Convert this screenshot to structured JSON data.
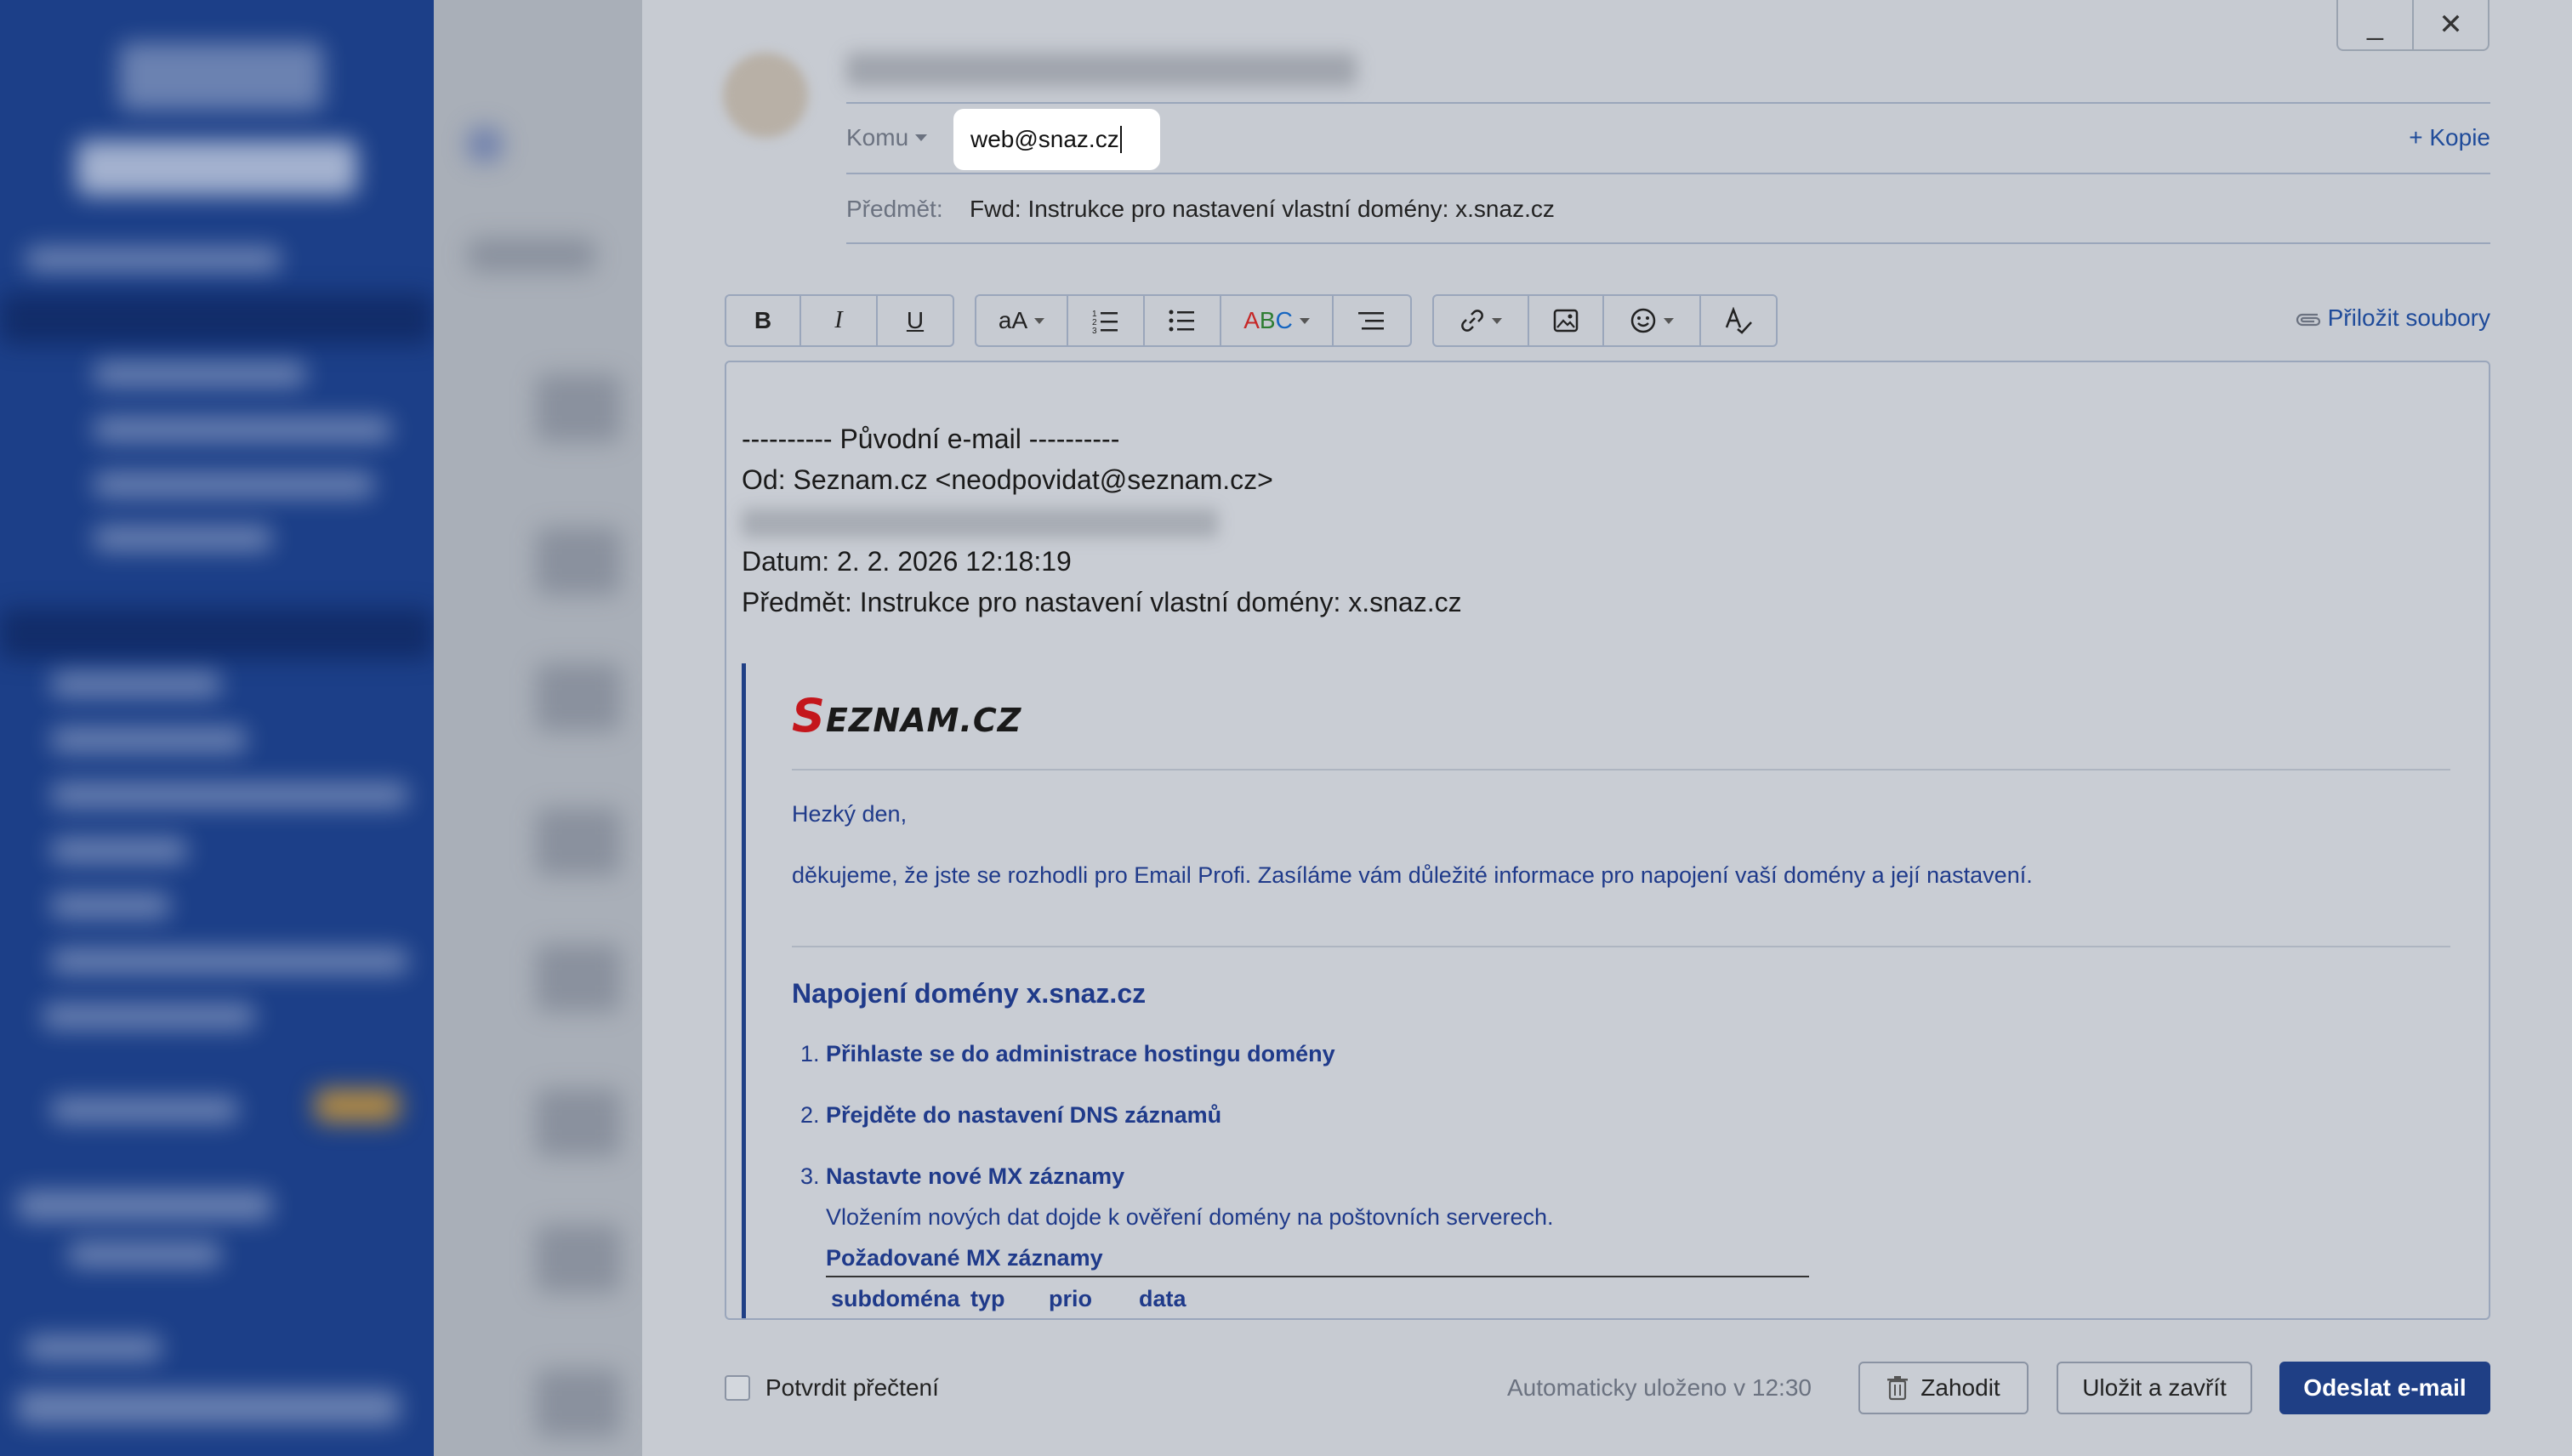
{
  "window": {
    "minimize_glyph": "_",
    "close_glyph": "✕"
  },
  "header": {
    "to_label": "Komu",
    "to_value": "web@snaz.cz",
    "cc_link": "+ Kopie",
    "subject_label": "Předmět:",
    "subject_value": "Fwd: Instrukce pro nastavení vlastní domény: x.snaz.cz"
  },
  "toolbar": {
    "bold": "B",
    "italic": "I",
    "underline": "U",
    "font_size": "aA",
    "text_color": "ABC",
    "attach_label": "Přiložit soubory",
    "icons": [
      "bold-icon",
      "italic-icon",
      "underline-icon",
      "font-size-icon",
      "ordered-list-icon",
      "bullet-list-icon",
      "text-color-icon",
      "align-icon",
      "link-icon",
      "image-icon",
      "emoji-icon",
      "spellcheck-icon",
      "paperclip-icon"
    ]
  },
  "body": {
    "original_header": "---------- Původní e-mail ----------",
    "from_line": "Od: Seznam.cz <neodpovidat@seznam.cz>",
    "date_line": "Datum: 2. 2. 2026 12:18:19",
    "subject_line": "Předmět: Instrukce pro nastavení vlastní domény: x.snaz.cz",
    "quote": {
      "logo_first": "S",
      "logo_rest": "EZNAM.CZ",
      "greeting": "Hezký den,",
      "intro": "děkujeme, že jste se rozhodli pro Email Profi. Zasíláme vám důležité informace pro napojení vaší domény a její nastavení.",
      "heading": "Napojení domény x.snaz.cz",
      "steps": [
        {
          "num": "1.",
          "text": "Přihlaste se do administrace hostingu domény"
        },
        {
          "num": "2.",
          "text": "Přejděte do nastavení DNS záznamů"
        },
        {
          "num": "3.",
          "text": "Nastavte nové MX záznamy"
        }
      ],
      "step3_note": "Vložením nových dat dojde k ověření domény na poštovních serverech.",
      "mx_title": "Požadované MX záznamy",
      "mx_columns": [
        "subdoména",
        "typ",
        "prio",
        "data"
      ]
    }
  },
  "footer": {
    "read_receipt": "Potvrdit přečtení",
    "autosave": "Automaticky uloženo v 12:30",
    "discard": "Zahodit",
    "save_close": "Uložit a zavřít",
    "send": "Odeslat e-mail"
  }
}
